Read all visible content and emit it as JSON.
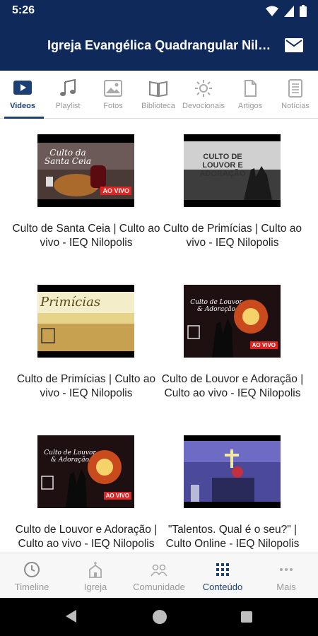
{
  "status_bar": {
    "time": "5:26"
  },
  "app_bar": {
    "title": "Igreja Evangélica Quadrangular Nilópolis"
  },
  "tabs": [
    {
      "label": "Videos",
      "icon": "video-play-icon",
      "active": true
    },
    {
      "label": "Playlist",
      "icon": "music-note-icon",
      "active": false
    },
    {
      "label": "Fotos",
      "icon": "photo-icon",
      "active": false
    },
    {
      "label": "Biblioteca",
      "icon": "book-icon",
      "active": false
    },
    {
      "label": "Devocionais",
      "icon": "sun-icon",
      "active": false
    },
    {
      "label": "Artigos",
      "icon": "document-icon",
      "active": false
    },
    {
      "label": "Notícias",
      "icon": "news-icon",
      "active": false
    }
  ],
  "videos": [
    {
      "title": "Culto de Santa Ceia | Culto ao vivo - IEQ Nilopolis",
      "thumb_text": "Culto da Santa Ceia",
      "badge": "AO VIVO"
    },
    {
      "title": "Culto de Primícias | Culto ao vivo - IEQ Nilopolis",
      "thumb_text": "CULTO DE LOUVOR E ADORAÇÃO"
    },
    {
      "title": "Culto de Primícias | Culto ao vivo - IEQ Nilopolis",
      "thumb_text": "Primícias"
    },
    {
      "title": "Culto de Louvor e Adoração | Culto ao vivo - IEQ Nilopolis",
      "thumb_text": "Culto de Louvor & Adoração",
      "badge": "AO VIVO"
    },
    {
      "title": "Culto de Louvor e Adoração | Culto ao vivo - IEQ Nilopolis",
      "thumb_text": "Culto de Louvor & Adoração",
      "badge": "AO VIVO"
    },
    {
      "title": "\"Talentos. Qual é o seu?\" | Culto Online - IEQ Nilopolis"
    }
  ],
  "bottom_nav": [
    {
      "label": "Timeline",
      "icon": "clock-icon",
      "active": false
    },
    {
      "label": "Igreja",
      "icon": "church-icon",
      "active": false
    },
    {
      "label": "Comunidade",
      "icon": "community-icon",
      "active": false
    },
    {
      "label": "Conteúdo",
      "icon": "grid-icon",
      "active": true
    },
    {
      "label": "Mais",
      "icon": "more-icon",
      "active": false
    }
  ],
  "colors": {
    "app_bar": "#0f2a5a",
    "accent": "#1c3f74",
    "inactive": "#9a9a9a",
    "live_badge": "#e32222"
  }
}
